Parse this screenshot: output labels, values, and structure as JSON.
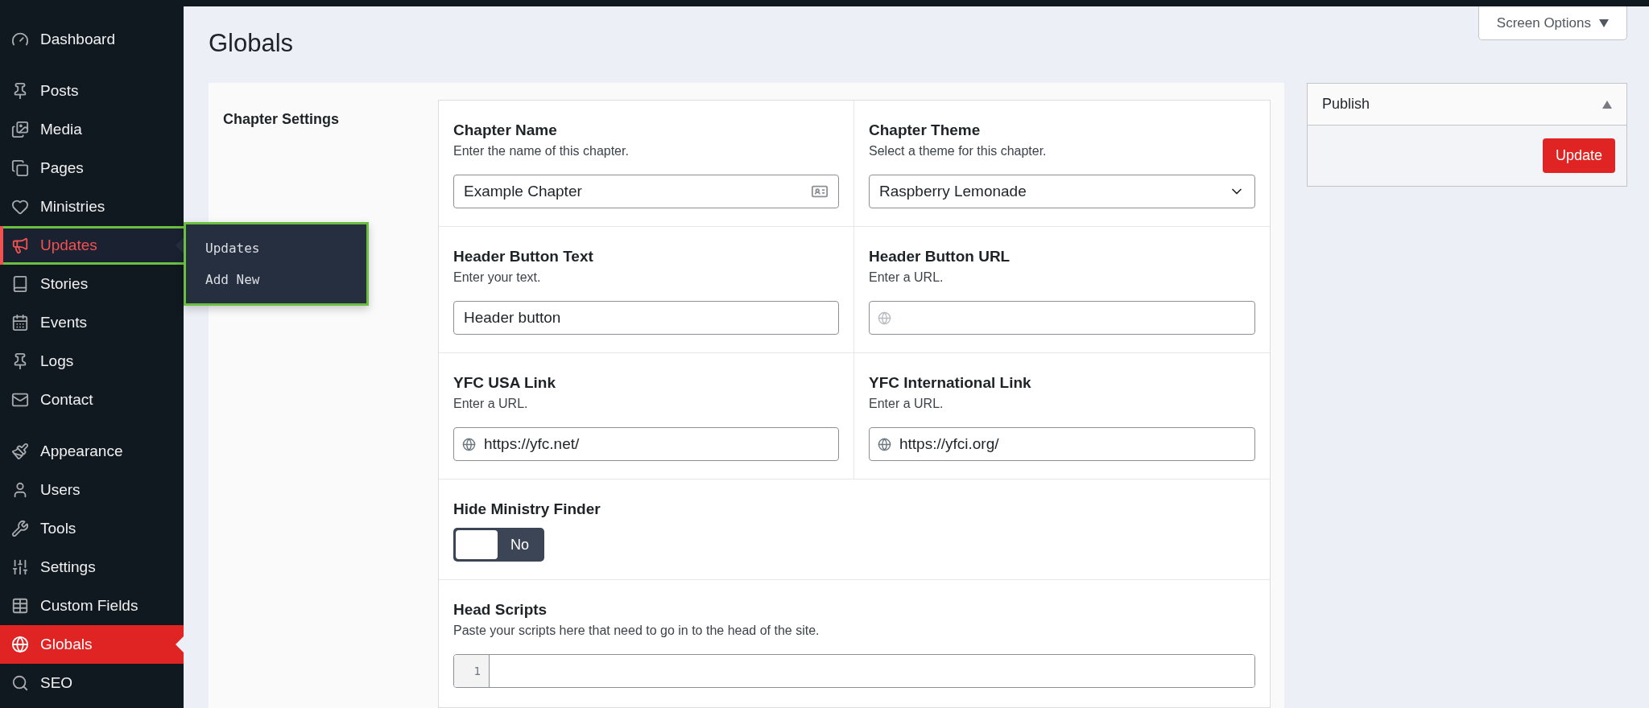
{
  "sidebar": {
    "groups": [
      {
        "items": [
          {
            "label": "Dashboard",
            "selected": false,
            "open": false
          }
        ]
      },
      {
        "items": [
          {
            "label": "Posts",
            "selected": false,
            "open": false
          },
          {
            "label": "Media",
            "selected": false,
            "open": false
          },
          {
            "label": "Pages",
            "selected": false,
            "open": false
          },
          {
            "label": "Ministries",
            "selected": false,
            "open": false
          },
          {
            "label": "Updates",
            "selected": false,
            "open": true,
            "submenu": [
              "Updates",
              "Add New"
            ]
          },
          {
            "label": "Stories",
            "selected": false,
            "open": false
          },
          {
            "label": "Events",
            "selected": false,
            "open": false
          },
          {
            "label": "Logs",
            "selected": false,
            "open": false
          },
          {
            "label": "Contact",
            "selected": false,
            "open": false
          }
        ]
      },
      {
        "items": [
          {
            "label": "Appearance",
            "selected": false,
            "open": false
          },
          {
            "label": "Users",
            "selected": false,
            "open": false
          },
          {
            "label": "Tools",
            "selected": false,
            "open": false
          },
          {
            "label": "Settings",
            "selected": false,
            "open": false
          },
          {
            "label": "Custom Fields",
            "selected": false,
            "open": false
          },
          {
            "label": "Globals",
            "selected": true,
            "open": false
          },
          {
            "label": "SEO",
            "selected": false,
            "open": false
          }
        ]
      }
    ]
  },
  "screen_options": "Screen Options",
  "page_title": "Globals",
  "section": {
    "title": "Chapter Settings",
    "fields": [
      {
        "kind": "text",
        "label": "Chapter Name",
        "description": "Enter the name of this chapter.",
        "value": "Example Chapter"
      },
      {
        "kind": "select",
        "label": "Chapter Theme",
        "description": "Select a theme for this chapter.",
        "value": "Raspberry Lemonade"
      },
      {
        "kind": "plain",
        "label": "Header Button Text",
        "description": "Enter your text.",
        "value": "Header button"
      },
      {
        "kind": "url",
        "label": "Header Button URL",
        "description": "Enter a URL."
      },
      {
        "kind": "url",
        "label": "YFC USA Link",
        "description": "Enter a URL.",
        "value": "https://yfc.net/"
      },
      {
        "kind": "url",
        "label": "YFC International Link",
        "description": "Enter a URL.",
        "value": "https://yfci.org/"
      },
      {
        "kind": "toggle",
        "label": "Hide Ministry Finder",
        "on": false,
        "value": "No"
      },
      {
        "kind": "code",
        "label": "Head Scripts",
        "description": "Paste your scripts here that need to go in to the head of the site.",
        "line_number": "1"
      }
    ]
  },
  "publish": {
    "title": "Publish",
    "expanded": true,
    "button": "Update"
  }
}
